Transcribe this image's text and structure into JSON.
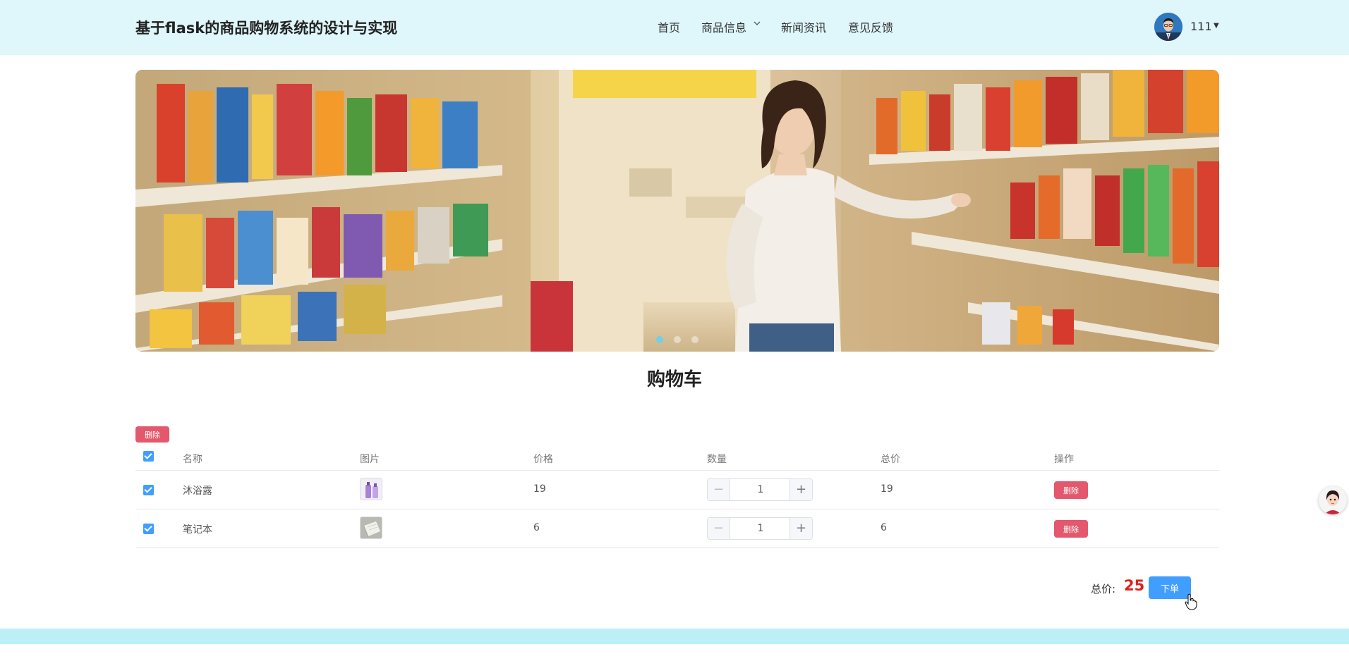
{
  "header": {
    "site_title": "基于flask的商品购物系统的设计与实现",
    "nav": [
      {
        "label": "首页"
      },
      {
        "label": "商品信息",
        "has_dropdown": true
      },
      {
        "label": "新闻资讯"
      },
      {
        "label": "意见反馈"
      }
    ],
    "user": {
      "name": "111",
      "avatar_icon": "user-avatar"
    }
  },
  "banner": {
    "slides_count": 3,
    "active_slide": 1
  },
  "cart": {
    "title": "购物车",
    "batch_delete_label": "删除",
    "columns": [
      "名称",
      "图片",
      "价格",
      "数量",
      "总价",
      "操作"
    ],
    "rows": [
      {
        "name": "沐浴露",
        "image_icon": "body-wash-image",
        "price": "19",
        "quantity": "1",
        "subtotal": "19",
        "action_label": "删除",
        "checked": true
      },
      {
        "name": "笔记本",
        "image_icon": "notebook-image",
        "price": "6",
        "quantity": "1",
        "subtotal": "6",
        "action_label": "删除",
        "checked": true
      }
    ],
    "select_all_checked": true,
    "total_label": "总价:",
    "total_value": "25",
    "order_button_label": "下单"
  },
  "colors": {
    "header_bg": "#dff6fb",
    "primary": "#409eff",
    "danger": "#e3586c",
    "total_red": "#e0201c",
    "footer_strip": "#bdeff7"
  }
}
